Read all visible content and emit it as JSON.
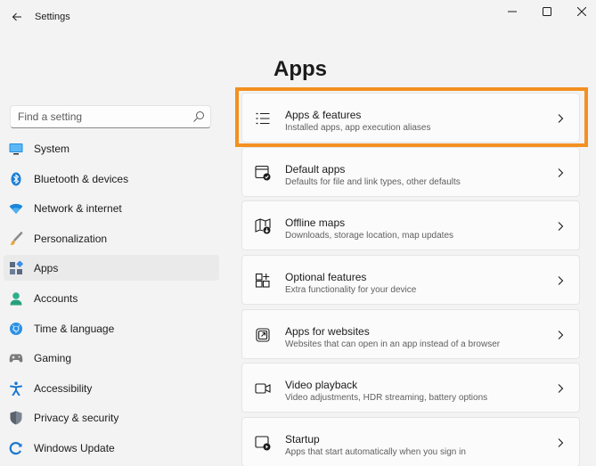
{
  "window": {
    "title": "Settings",
    "controls": {
      "minimize": "minimize-icon",
      "maximize": "maximize-icon",
      "close": "close-icon"
    }
  },
  "search": {
    "placeholder": "Find a setting"
  },
  "sidebar": {
    "items": [
      {
        "label": "System",
        "icon": "system-icon"
      },
      {
        "label": "Bluetooth & devices",
        "icon": "bluetooth-icon"
      },
      {
        "label": "Network & internet",
        "icon": "network-icon"
      },
      {
        "label": "Personalization",
        "icon": "brush-icon"
      },
      {
        "label": "Apps",
        "icon": "apps-icon",
        "active": true
      },
      {
        "label": "Accounts",
        "icon": "account-icon"
      },
      {
        "label": "Time & language",
        "icon": "globe-icon"
      },
      {
        "label": "Gaming",
        "icon": "gamepad-icon"
      },
      {
        "label": "Accessibility",
        "icon": "accessibility-icon"
      },
      {
        "label": "Privacy & security",
        "icon": "shield-icon"
      },
      {
        "label": "Windows Update",
        "icon": "update-icon"
      }
    ]
  },
  "main": {
    "title": "Apps",
    "cards": [
      {
        "title": "Apps & features",
        "subtitle": "Installed apps, app execution aliases",
        "icon": "list-icon"
      },
      {
        "title": "Default apps",
        "subtitle": "Defaults for file and link types, other defaults",
        "icon": "default-apps-icon"
      },
      {
        "title": "Offline maps",
        "subtitle": "Downloads, storage location, map updates",
        "icon": "map-icon"
      },
      {
        "title": "Optional features",
        "subtitle": "Extra functionality for your device",
        "icon": "optional-features-icon"
      },
      {
        "title": "Apps for websites",
        "subtitle": "Websites that can open in an app instead of a browser",
        "icon": "open-external-icon"
      },
      {
        "title": "Video playback",
        "subtitle": "Video adjustments, HDR streaming, battery options",
        "icon": "video-icon"
      },
      {
        "title": "Startup",
        "subtitle": "Apps that start automatically when you sign in",
        "icon": "startup-icon"
      }
    ]
  },
  "colors": {
    "highlight": "#f3901f",
    "accent": "#0067c0"
  }
}
